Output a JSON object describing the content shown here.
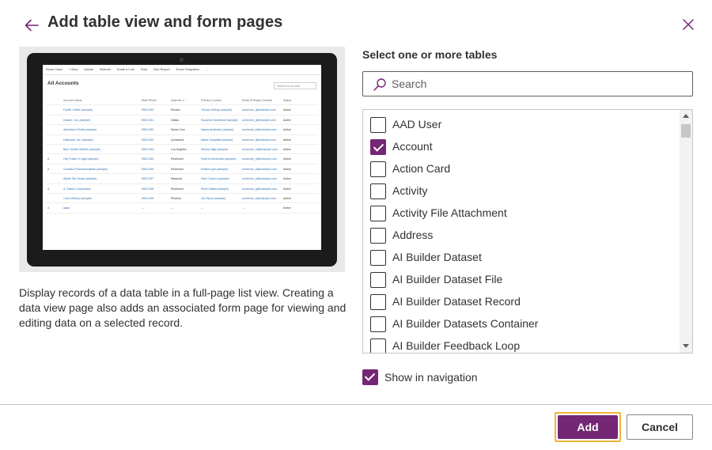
{
  "dialog": {
    "title": "Add table view and form pages",
    "accent_color": "#742774",
    "focus_color": "#f1b43a"
  },
  "preview": {
    "command_bar": [
      "Show Chart",
      "+ New",
      "Delete",
      "Refresh",
      "Email a Link",
      "Flow",
      "Run Report",
      "Excel Templates",
      "..."
    ],
    "view_title": "All Accounts",
    "search_placeholder": "Search for records",
    "columns": [
      "",
      "Account Name",
      "Main Phone",
      "Address 1: ...",
      "Primary Contact",
      "Email (Primary Contact)",
      "Status"
    ],
    "rows": [
      [
        "",
        "Fourth Coffee (sample)",
        "555-0150",
        "Renton",
        "Yvonne McKay (sample)",
        "someone_i@example.com",
        "Active"
      ],
      [
        "",
        "Litware, Inc. (sample)",
        "555-0151",
        "Dallas",
        "Susanna Stubberod (sample)",
        "someone_j@example.com",
        "Active"
      ],
      [
        "",
        "Adventure Works (sample)",
        "555-0152",
        "Santa Cruz",
        "Nancy Anderson (sample)",
        "someone_k@example.com",
        "Active"
      ],
      [
        "",
        "Fabrikam, Inc. (sample)",
        "555-0153",
        "Lynnwood",
        "Maria Campbell (sample)",
        "someone_l@example.com",
        "Active"
      ],
      [
        "",
        "Blue Yonder Airlines (sample)",
        "555-0154",
        "Los Angeles",
        "Sidney Higa (sample)",
        "someone_m@example.com",
        "Active"
      ],
      [
        "A",
        "City Power & Light (sample)",
        "555-0155",
        "Redmond",
        "Scott Konersmann (sample)",
        "someone_n@example.com",
        "Active"
      ],
      [
        "A",
        "Contoso Pharmaceuticals (sample)",
        "555-0156",
        "Redmond",
        "Robert Lyon (sample)",
        "someone_o@example.com",
        "Active"
      ],
      [
        "",
        "Alpine Ski House (sample)",
        "555-0157",
        "Missoula",
        "Paul Cannon (sample)",
        "someone_p@example.com",
        "Active"
      ],
      [
        "A",
        "A. Datum Corporation",
        "555-0158",
        "Redmond",
        "Rene Valdes (sample)",
        "someone_q@example.com",
        "Active"
      ],
      [
        "",
        "Coho Winery (sample)",
        "555-0159",
        "Phoenix",
        "Jim Glynn (sample)",
        "someone_r@example.com",
        "Active"
      ],
      [
        "A",
        "aaaa",
        "---",
        "---",
        "---",
        "---",
        "Active"
      ]
    ]
  },
  "description": "Display records of a data table in a full-page list view. Creating a data view page also adds an associated form page for viewing and editing data on a selected record.",
  "tables": {
    "label": "Select one or more tables",
    "search_placeholder": "Search",
    "search_value": "",
    "items": [
      {
        "label": "AAD User",
        "checked": false
      },
      {
        "label": "Account",
        "checked": true
      },
      {
        "label": "Action Card",
        "checked": false
      },
      {
        "label": "Activity",
        "checked": false
      },
      {
        "label": "Activity File Attachment",
        "checked": false
      },
      {
        "label": "Address",
        "checked": false
      },
      {
        "label": "AI Builder Dataset",
        "checked": false
      },
      {
        "label": "AI Builder Dataset File",
        "checked": false
      },
      {
        "label": "AI Builder Dataset Record",
        "checked": false
      },
      {
        "label": "AI Builder Datasets Container",
        "checked": false
      },
      {
        "label": "AI Builder Feedback Loop",
        "checked": false
      }
    ]
  },
  "navigation": {
    "label": "Show in navigation",
    "checked": true
  },
  "footer": {
    "add_label": "Add",
    "cancel_label": "Cancel"
  }
}
